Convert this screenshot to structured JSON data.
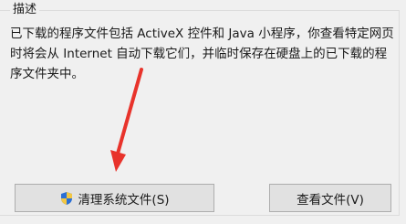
{
  "groupbox": {
    "title": "描述",
    "description": "已下载的程序文件包括 ActiveX 控件和 Java 小程序，你查看特定网页时将会从 Internet 自动下载它们，并临时保存在硬盘上的已下载的程序文件夹中。"
  },
  "buttons": {
    "clean_label": "清理系统文件(S)",
    "view_label": "查看文件(V)"
  },
  "colors": {
    "arrow": "#e8332b",
    "shield_blue": "#2a6fd6",
    "shield_yellow": "#f2c744"
  }
}
